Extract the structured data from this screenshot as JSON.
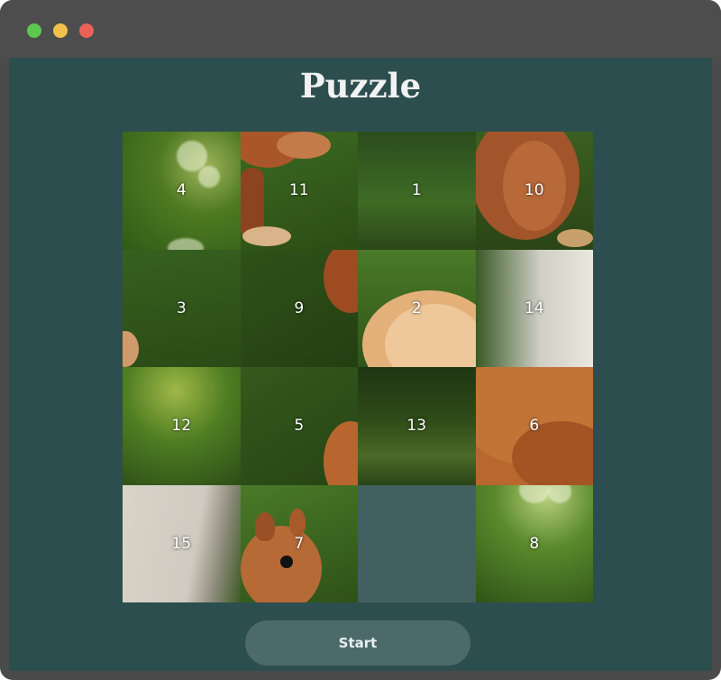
{
  "window": {
    "controls": [
      "close-green",
      "minimize-yellow",
      "maximize-red"
    ]
  },
  "page": {
    "title": "Puzzle"
  },
  "puzzle": {
    "grid_size": 4,
    "tiles": [
      {
        "row": 0,
        "col": 0,
        "label": "4"
      },
      {
        "row": 0,
        "col": 1,
        "label": "11"
      },
      {
        "row": 0,
        "col": 2,
        "label": "1"
      },
      {
        "row": 0,
        "col": 3,
        "label": "10"
      },
      {
        "row": 1,
        "col": 0,
        "label": "3"
      },
      {
        "row": 1,
        "col": 1,
        "label": "9"
      },
      {
        "row": 1,
        "col": 2,
        "label": "2"
      },
      {
        "row": 1,
        "col": 3,
        "label": "14"
      },
      {
        "row": 2,
        "col": 0,
        "label": "12"
      },
      {
        "row": 2,
        "col": 1,
        "label": "5"
      },
      {
        "row": 2,
        "col": 2,
        "label": "13"
      },
      {
        "row": 2,
        "col": 3,
        "label": "6"
      },
      {
        "row": 3,
        "col": 0,
        "label": "15"
      },
      {
        "row": 3,
        "col": 1,
        "label": "7"
      },
      {
        "row": 3,
        "col": 2,
        "label": ""
      },
      {
        "row": 3,
        "col": 3,
        "label": "8"
      }
    ],
    "empty_cell": {
      "row": 3,
      "col": 2
    }
  },
  "controls": {
    "start_label": "Start"
  },
  "colors": {
    "background": "#2d4e4f",
    "empty_tile": "#436061",
    "button": "#4d6a6b"
  }
}
